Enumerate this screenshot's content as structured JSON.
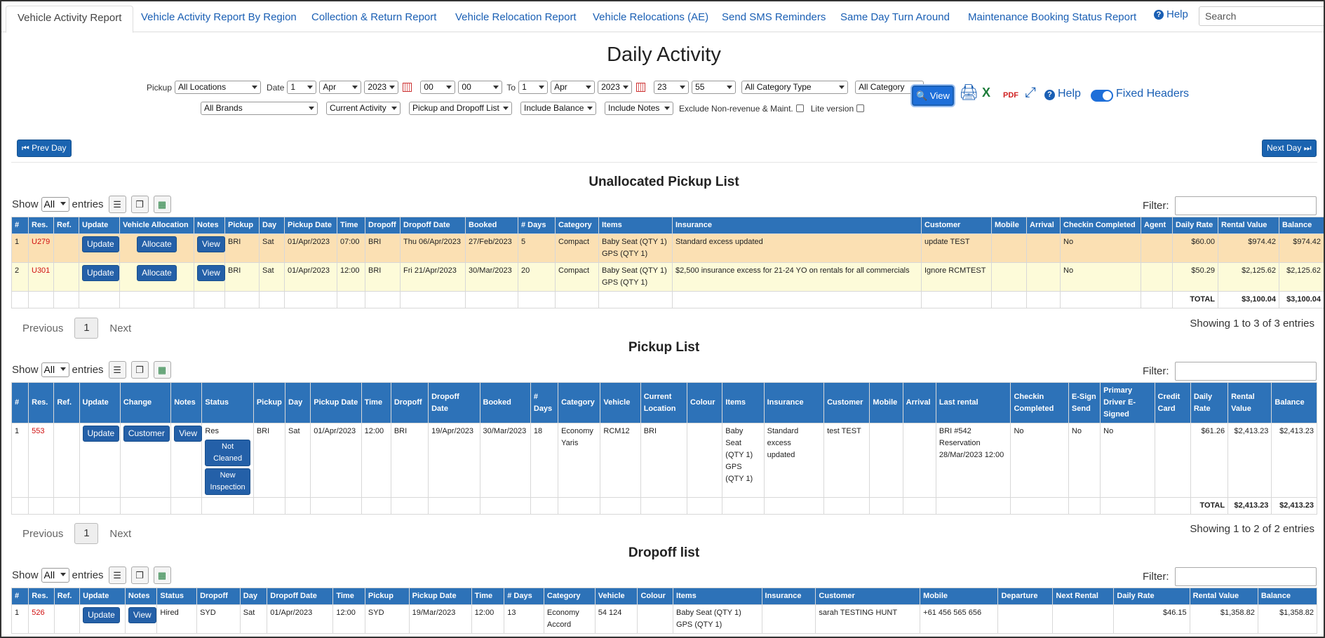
{
  "nav": {
    "tabs": [
      "Vehicle Activity Report",
      "Vehicle Activity Report By Region",
      "Collection & Return Report",
      "Vehicle Relocation Report",
      "Vehicle Relocations (AE)",
      "Send SMS Reminders",
      "Same Day Turn Around",
      "Maintenance Booking Status Report"
    ],
    "help": "Help",
    "search_placeholder": "Search"
  },
  "page_title": "Daily Activity",
  "filters": {
    "pickup_label": "Pickup",
    "pickup_location": "All Locations",
    "date_label": "Date",
    "date_day": "1",
    "date_month": "Apr",
    "date_year": "2023",
    "date_hour": "00",
    "date_min": "00",
    "to_label": "To",
    "to_day": "1",
    "to_month": "Apr",
    "to_year": "2023",
    "to_hour": "23",
    "to_min": "55",
    "category_type": "All Category Type",
    "category": "All Category",
    "brands": "All Brands",
    "activity": "Current Activity",
    "list_type": "Pickup and Dropoff List",
    "balance": "Include Balance",
    "notes": "Include Notes",
    "exclude_label": "Exclude Non-revenue & Maint.",
    "lite_label": "Lite version",
    "view_button": "View",
    "help": "Help",
    "fixed_headers": "Fixed Headers"
  },
  "prev_day": "Prev Day",
  "next_day": "Next Day",
  "show_label": "Show",
  "show_value": "All",
  "entries_label": "entries",
  "filter_label": "Filter:",
  "pager": {
    "previous": "Previous",
    "page": "1",
    "next": "Next"
  },
  "unallocated": {
    "title": "Unallocated Pickup List",
    "headers": [
      "#",
      "Res.",
      "Ref.",
      "Update",
      "Vehicle Allocation",
      "Notes",
      "Pickup",
      "Day",
      "Pickup Date",
      "Time",
      "Dropoff",
      "Dropoff Date",
      "Booked",
      "# Days",
      "Category",
      "Items",
      "Insurance",
      "Customer",
      "Mobile",
      "Arrival",
      "Checkin Completed",
      "Agent",
      "Daily Rate",
      "Rental Value",
      "Balance"
    ],
    "rows": [
      {
        "n": "1",
        "res": "U279",
        "ref": "",
        "update": "Update",
        "alloc": "Allocate",
        "notes": "View",
        "pickup": "BRI",
        "day": "Sat",
        "pdate": "01/Apr/2023",
        "time": "07:00",
        "dropoff": "BRI",
        "ddate": "Thu 06/Apr/2023",
        "booked": "27/Feb/2023",
        "days": "5",
        "category": "Compact",
        "items": "Baby Seat (QTY 1) GPS (QTY 1)",
        "insurance": "Standard excess updated",
        "customer": "update TEST",
        "mobile": "",
        "arrival": "",
        "checkin": "No",
        "agent": "",
        "rate": "$60.00",
        "value": "$974.42",
        "balance": "$974.42"
      },
      {
        "n": "2",
        "res": "U301",
        "ref": "",
        "update": "Update",
        "alloc": "Allocate",
        "notes": "View",
        "pickup": "BRI",
        "day": "Sat",
        "pdate": "01/Apr/2023",
        "time": "12:00",
        "dropoff": "BRI",
        "ddate": "Fri 21/Apr/2023",
        "booked": "30/Mar/2023",
        "days": "20",
        "category": "Compact",
        "items": "Baby Seat (QTY 1) GPS (QTY 1)",
        "insurance": "$2,500 insurance excess for 21-24 YO on rentals for all commercials",
        "customer": "Ignore RCMTEST",
        "mobile": "",
        "arrival": "",
        "checkin": "No",
        "agent": "",
        "rate": "$50.29",
        "value": "$2,125.62",
        "balance": "$2,125.62"
      }
    ],
    "total_label": "TOTAL",
    "total_value": "$3,100.04",
    "total_balance": "$3,100.04",
    "showing": "Showing 1 to 3 of 3 entries"
  },
  "pickup": {
    "title": "Pickup List",
    "headers": [
      "#",
      "Res.",
      "Ref.",
      "Update",
      "Change",
      "Notes",
      "Status",
      "Pickup",
      "Day",
      "Pickup Date",
      "Time",
      "Dropoff",
      "Dropoff Date",
      "Booked",
      "# Days",
      "Category",
      "Vehicle",
      "Current Location",
      "Colour",
      "Items",
      "Insurance",
      "Customer",
      "Mobile",
      "Arrival",
      "Last rental",
      "Checkin Completed",
      "E-Sign Send",
      "Primary Driver E-Signed",
      "Credit Card",
      "Daily Rate",
      "Rental Value",
      "Balance"
    ],
    "row": {
      "n": "1",
      "res": "553",
      "ref": "",
      "update": "Update",
      "change": "Customer",
      "notes": "View",
      "status": "Res",
      "status_btn1": "Not Cleaned",
      "status_btn2": "New Inspection",
      "pickup": "BRI",
      "day": "Sat",
      "pdate": "01/Apr/2023",
      "time": "12:00",
      "dropoff": "BRI",
      "ddate": "19/Apr/2023",
      "booked": "30/Mar/2023",
      "days": "18",
      "category": "Economy Yaris",
      "vehicle": "RCM12",
      "location": "BRI",
      "colour": "",
      "items": "Baby Seat (QTY 1) GPS (QTY 1)",
      "insurance": "Standard excess updated",
      "customer": "test TEST",
      "mobile": "",
      "arrival": "",
      "last_rental": "BRI #542 Reservation 28/Mar/2023 12:00",
      "checkin": "No",
      "esign": "No",
      "primary": "No",
      "card": "",
      "rate": "$61.26",
      "value": "$2,413.23",
      "balance": "$2,413.23"
    },
    "total_label": "TOTAL",
    "total_value": "$2,413.23",
    "total_balance": "$2,413.23",
    "showing": "Showing 1 to 2 of 2 entries"
  },
  "dropoff": {
    "title": "Dropoff list",
    "headers": [
      "#",
      "Res.",
      "Ref.",
      "Update",
      "Notes",
      "Status",
      "Dropoff",
      "Day",
      "Dropoff Date",
      "Time",
      "Pickup",
      "Pickup Date",
      "Time",
      "# Days",
      "Category",
      "Vehicle",
      "Colour",
      "Items",
      "Insurance",
      "Customer",
      "Mobile",
      "Departure",
      "Next Rental",
      "Daily Rate",
      "Rental Value",
      "Balance"
    ],
    "row": {
      "n": "1",
      "res": "526",
      "ref": "",
      "update": "Update",
      "notes": "View",
      "status": "Hired",
      "dropoff": "SYD",
      "day": "Sat",
      "ddate": "01/Apr/2023",
      "time": "12:00",
      "pickup": "SYD",
      "pdate": "19/Mar/2023",
      "ptime": "12:00",
      "days": "13",
      "category": "Economy Accord",
      "vehicle": "54 124",
      "colour": "",
      "items": "Baby Seat (QTY 1) GPS (QTY 1)",
      "insurance": "",
      "customer": "sarah TESTING HUNT",
      "mobile": "+61 456 565 656",
      "departure": "",
      "next": "",
      "rate": "$46.15",
      "value": "$1,358.82",
      "balance": "$1,358.82"
    }
  },
  "colors": {
    "header_blue": "#2d72b8",
    "link_blue": "#1a5fb4",
    "row_orange": "#fbe0b3",
    "row_yellow": "#fdfbd9",
    "res_red": "#d01010"
  }
}
